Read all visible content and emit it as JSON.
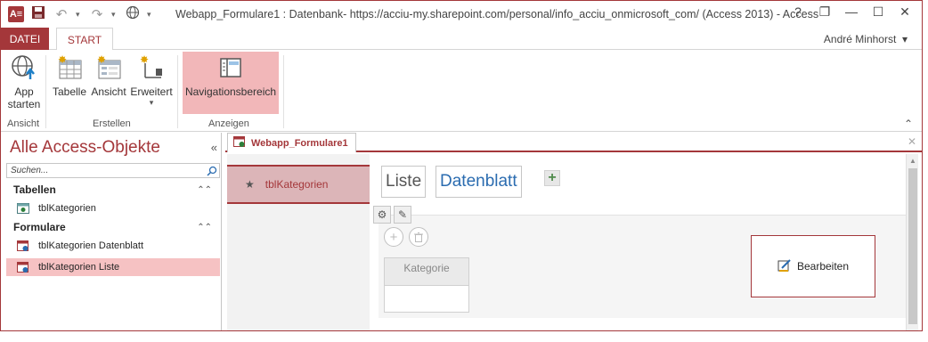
{
  "window": {
    "title": "Webapp_Formulare1 : Datenbank- https://acciu-my.sharepoint.com/personal/info_acciu_onmicrosoft_com/ (Access 2013) - Access",
    "app_icon_text": "A≡",
    "controls": {
      "help": "?",
      "restore": "❐",
      "minimize": "—",
      "maximize": "☐",
      "close": "✕"
    }
  },
  "qat": {
    "save_icon": "save-icon",
    "undo_icon": "undo-icon",
    "redo_icon": "redo-icon",
    "web_icon": "globe-icon"
  },
  "tabs": [
    {
      "label": "DATEI"
    },
    {
      "label": "START"
    }
  ],
  "user": {
    "name": "André Minhorst"
  },
  "ribbon": {
    "groups": [
      {
        "label": "Ansicht"
      },
      {
        "label": "Erstellen"
      },
      {
        "label": "Anzeigen"
      }
    ],
    "buttons": {
      "app_starten_line1": "App",
      "app_starten_line2": "starten",
      "tabelle": "Tabelle",
      "ansicht": "Ansicht",
      "erweitert": "Erweitert",
      "navigationsbereich": "Navigationsbereich"
    }
  },
  "navpane": {
    "title": "Alle Access-Objekte",
    "search_placeholder": "Suchen...",
    "categories": [
      {
        "label": "Tabellen",
        "items": [
          {
            "label": "tblKategorien"
          }
        ]
      },
      {
        "label": "Formulare",
        "items": [
          {
            "label": "tblKategorien Datenblatt"
          },
          {
            "label": "tblKategorien Liste"
          }
        ]
      }
    ]
  },
  "document": {
    "tab_label": "Webapp_Formulare1",
    "table_list": [
      {
        "label": "tblKategorien"
      }
    ],
    "views": [
      {
        "label": "Liste"
      },
      {
        "label": "Datenblatt"
      }
    ],
    "field_label": "Kategorie",
    "edit_button": "Bearbeiten"
  },
  "colors": {
    "accent": "#a4373a",
    "selected_bg": "#f6c2c3",
    "nav_highlight": "#f2b7b9",
    "link_blue": "#2b6cb0"
  }
}
